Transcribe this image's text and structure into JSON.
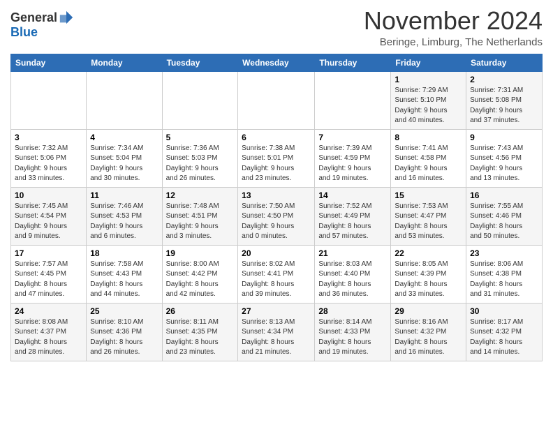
{
  "logo": {
    "general": "General",
    "blue": "Blue"
  },
  "header": {
    "title": "November 2024",
    "location": "Beringe, Limburg, The Netherlands"
  },
  "weekdays": [
    "Sunday",
    "Monday",
    "Tuesday",
    "Wednesday",
    "Thursday",
    "Friday",
    "Saturday"
  ],
  "weeks": [
    [
      {
        "day": "",
        "info": ""
      },
      {
        "day": "",
        "info": ""
      },
      {
        "day": "",
        "info": ""
      },
      {
        "day": "",
        "info": ""
      },
      {
        "day": "",
        "info": ""
      },
      {
        "day": "1",
        "info": "Sunrise: 7:29 AM\nSunset: 5:10 PM\nDaylight: 9 hours\nand 40 minutes."
      },
      {
        "day": "2",
        "info": "Sunrise: 7:31 AM\nSunset: 5:08 PM\nDaylight: 9 hours\nand 37 minutes."
      }
    ],
    [
      {
        "day": "3",
        "info": "Sunrise: 7:32 AM\nSunset: 5:06 PM\nDaylight: 9 hours\nand 33 minutes."
      },
      {
        "day": "4",
        "info": "Sunrise: 7:34 AM\nSunset: 5:04 PM\nDaylight: 9 hours\nand 30 minutes."
      },
      {
        "day": "5",
        "info": "Sunrise: 7:36 AM\nSunset: 5:03 PM\nDaylight: 9 hours\nand 26 minutes."
      },
      {
        "day": "6",
        "info": "Sunrise: 7:38 AM\nSunset: 5:01 PM\nDaylight: 9 hours\nand 23 minutes."
      },
      {
        "day": "7",
        "info": "Sunrise: 7:39 AM\nSunset: 4:59 PM\nDaylight: 9 hours\nand 19 minutes."
      },
      {
        "day": "8",
        "info": "Sunrise: 7:41 AM\nSunset: 4:58 PM\nDaylight: 9 hours\nand 16 minutes."
      },
      {
        "day": "9",
        "info": "Sunrise: 7:43 AM\nSunset: 4:56 PM\nDaylight: 9 hours\nand 13 minutes."
      }
    ],
    [
      {
        "day": "10",
        "info": "Sunrise: 7:45 AM\nSunset: 4:54 PM\nDaylight: 9 hours\nand 9 minutes."
      },
      {
        "day": "11",
        "info": "Sunrise: 7:46 AM\nSunset: 4:53 PM\nDaylight: 9 hours\nand 6 minutes."
      },
      {
        "day": "12",
        "info": "Sunrise: 7:48 AM\nSunset: 4:51 PM\nDaylight: 9 hours\nand 3 minutes."
      },
      {
        "day": "13",
        "info": "Sunrise: 7:50 AM\nSunset: 4:50 PM\nDaylight: 9 hours\nand 0 minutes."
      },
      {
        "day": "14",
        "info": "Sunrise: 7:52 AM\nSunset: 4:49 PM\nDaylight: 8 hours\nand 57 minutes."
      },
      {
        "day": "15",
        "info": "Sunrise: 7:53 AM\nSunset: 4:47 PM\nDaylight: 8 hours\nand 53 minutes."
      },
      {
        "day": "16",
        "info": "Sunrise: 7:55 AM\nSunset: 4:46 PM\nDaylight: 8 hours\nand 50 minutes."
      }
    ],
    [
      {
        "day": "17",
        "info": "Sunrise: 7:57 AM\nSunset: 4:45 PM\nDaylight: 8 hours\nand 47 minutes."
      },
      {
        "day": "18",
        "info": "Sunrise: 7:58 AM\nSunset: 4:43 PM\nDaylight: 8 hours\nand 44 minutes."
      },
      {
        "day": "19",
        "info": "Sunrise: 8:00 AM\nSunset: 4:42 PM\nDaylight: 8 hours\nand 42 minutes."
      },
      {
        "day": "20",
        "info": "Sunrise: 8:02 AM\nSunset: 4:41 PM\nDaylight: 8 hours\nand 39 minutes."
      },
      {
        "day": "21",
        "info": "Sunrise: 8:03 AM\nSunset: 4:40 PM\nDaylight: 8 hours\nand 36 minutes."
      },
      {
        "day": "22",
        "info": "Sunrise: 8:05 AM\nSunset: 4:39 PM\nDaylight: 8 hours\nand 33 minutes."
      },
      {
        "day": "23",
        "info": "Sunrise: 8:06 AM\nSunset: 4:38 PM\nDaylight: 8 hours\nand 31 minutes."
      }
    ],
    [
      {
        "day": "24",
        "info": "Sunrise: 8:08 AM\nSunset: 4:37 PM\nDaylight: 8 hours\nand 28 minutes."
      },
      {
        "day": "25",
        "info": "Sunrise: 8:10 AM\nSunset: 4:36 PM\nDaylight: 8 hours\nand 26 minutes."
      },
      {
        "day": "26",
        "info": "Sunrise: 8:11 AM\nSunset: 4:35 PM\nDaylight: 8 hours\nand 23 minutes."
      },
      {
        "day": "27",
        "info": "Sunrise: 8:13 AM\nSunset: 4:34 PM\nDaylight: 8 hours\nand 21 minutes."
      },
      {
        "day": "28",
        "info": "Sunrise: 8:14 AM\nSunset: 4:33 PM\nDaylight: 8 hours\nand 19 minutes."
      },
      {
        "day": "29",
        "info": "Sunrise: 8:16 AM\nSunset: 4:32 PM\nDaylight: 8 hours\nand 16 minutes."
      },
      {
        "day": "30",
        "info": "Sunrise: 8:17 AM\nSunset: 4:32 PM\nDaylight: 8 hours\nand 14 minutes."
      }
    ]
  ]
}
